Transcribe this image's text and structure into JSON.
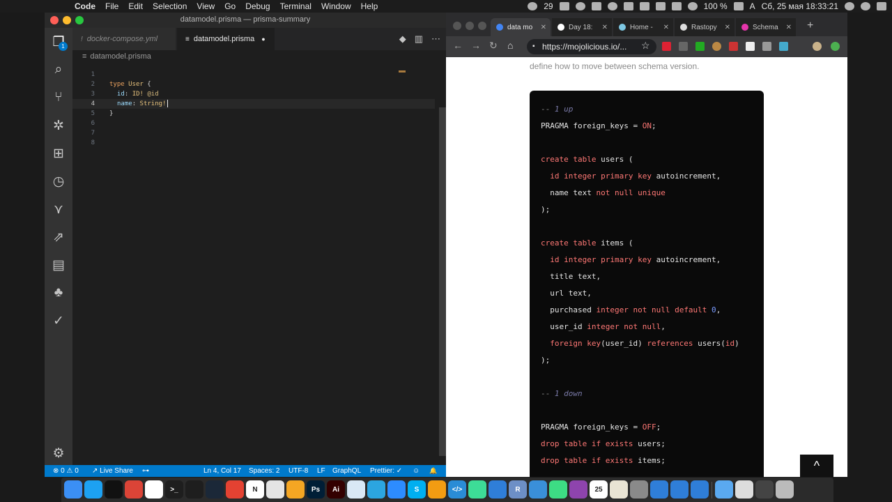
{
  "menubar": {
    "apple_glyph": "",
    "app_name": "Code",
    "items": [
      "File",
      "Edit",
      "Selection",
      "View",
      "Go",
      "Debug",
      "Terminal",
      "Window",
      "Help"
    ],
    "notifications_count": "29",
    "battery": "100 %",
    "input_source": "A",
    "datetime": "Сб, 25 мая  18:33:21"
  },
  "vscode": {
    "window_title": "datamodel.prisma — prisma-summary",
    "tabs": [
      {
        "label": "docker-compose.yml",
        "icon": "!"
      },
      {
        "label": "datamodel.prisma",
        "icon": "≡",
        "modified_dot": "●"
      }
    ],
    "explorer_badge": "1",
    "breadcrumb": "datamodel.prisma",
    "line_numbers": [
      "1",
      "2",
      "3",
      "4",
      "5",
      "6",
      "7",
      "8"
    ],
    "code": {
      "line2_kw": "type",
      "line2_name": "User",
      "line2_brace": " {",
      "line3_field": "id",
      "line3_colon": ": ",
      "line3_type": "ID!",
      "line3_attr": " @id",
      "line4_field": "name",
      "line4_colon": ": ",
      "line4_type": "String!",
      "line5_brace": "}"
    },
    "status": {
      "problems": "⊗ 0 ⚠ 0",
      "live_share": "↗ Live Share",
      "position": "Ln 4, Col 17",
      "spaces": "Spaces: 2",
      "encoding": "UTF-8",
      "eol": "LF",
      "language": "GraphQL",
      "prettier": "Prettier: ✓",
      "smiley": "☺",
      "bell": "🔔"
    }
  },
  "browser": {
    "tabs": [
      {
        "label": "data mo",
        "favicon_color": "#4285f4",
        "active": true
      },
      {
        "label": "Day 18:",
        "favicon_color": "#ffffff",
        "active": false
      },
      {
        "label": "Home -",
        "favicon_color": "#7ec8e3",
        "active": false
      },
      {
        "label": "Rastopy",
        "favicon_color": "#dddddd",
        "active": false
      },
      {
        "label": "Schema",
        "favicon_color": "#e535ab",
        "active": false
      }
    ],
    "url": "https://mojolicious.io/...",
    "page_text": "define how to move between schema version.",
    "code_lines": {
      "l1_c": "-- ",
      "l1_n": "1 up",
      "l2_a": "PRAGMA foreign_keys = ",
      "l2_b": "ON",
      "l2_c": ";",
      "l4_a": "create table",
      "l4_b": " users (",
      "l5_a": "  id integer primary key",
      "l5_b": " autoincrement,",
      "l6_a": "  name text ",
      "l6_b": "not null unique",
      "l7": ");",
      "l9_a": "create table",
      "l9_b": " items (",
      "l10_a": "  id integer primary key",
      "l10_b": " autoincrement,",
      "l11": "  title text,",
      "l12": "  url text,",
      "l13_a": "  purchased ",
      "l13_b": "integer not null default",
      "l13_c": " 0",
      "l13_d": ",",
      "l14_a": "  user_id ",
      "l14_b": "integer not null",
      "l14_c": ",",
      "l15_a": "  foreign key",
      "l15_b": "(user_id) ",
      "l15_c": "references",
      "l15_d": " users(",
      "l15_e": "id",
      "l15_f": ")",
      "l16": ");",
      "l18_c": "-- ",
      "l18_n": "1 down",
      "l20_a": "PRAGMA foreign_keys = ",
      "l20_b": "OFF",
      "l20_c": ";",
      "l21_a": "drop table if exists",
      "l21_b": " users;",
      "l22_a": "drop table if exists",
      "l22_b": " items;"
    },
    "scroll_top_glyph": "^"
  },
  "dock": {
    "apps": [
      {
        "name": "finder",
        "color": "#3b8ff5",
        "glyph": ""
      },
      {
        "name": "tweetbot",
        "color": "#1da1f2",
        "glyph": ""
      },
      {
        "name": "safari",
        "color": "#111111",
        "glyph": ""
      },
      {
        "name": "chrome",
        "color": "#db4437",
        "glyph": ""
      },
      {
        "name": "slack",
        "color": "#ffffff",
        "glyph": ""
      },
      {
        "name": "terminal",
        "color": "#1e1e1e",
        "glyph": ">_"
      },
      {
        "name": "iterm",
        "color": "#1e1e1e",
        "glyph": ""
      },
      {
        "name": "steam",
        "color": "#1b2838",
        "glyph": ""
      },
      {
        "name": "todoist",
        "color": "#e44232",
        "glyph": ""
      },
      {
        "name": "notion",
        "color": "#ffffff",
        "glyph": "N"
      },
      {
        "name": "things",
        "color": "#e4e4e4",
        "glyph": ""
      },
      {
        "name": "books",
        "color": "#f5a623",
        "glyph": ""
      },
      {
        "name": "photoshop",
        "color": "#001e36",
        "glyph": "Ps"
      },
      {
        "name": "illustrator",
        "color": "#330000",
        "glyph": "Ai"
      },
      {
        "name": "mail",
        "color": "#d9e8f5",
        "glyph": ""
      },
      {
        "name": "telegram",
        "color": "#2ca5e0",
        "glyph": ""
      },
      {
        "name": "zoom",
        "color": "#2d8cff",
        "glyph": ""
      },
      {
        "name": "skype",
        "color": "#00aff0",
        "glyph": "S"
      },
      {
        "name": "paw",
        "color": "#f39c12",
        "glyph": ""
      },
      {
        "name": "brackets",
        "color": "#2a8cd6",
        "glyph": "</>"
      },
      {
        "name": "atom",
        "color": "#3ddc97",
        "glyph": ""
      },
      {
        "name": "vscode",
        "color": "#2f7ed8",
        "glyph": ""
      },
      {
        "name": "r",
        "color": "#6d8fc6",
        "glyph": "R"
      },
      {
        "name": "sequelpro",
        "color": "#3a8fd9",
        "glyph": ""
      },
      {
        "name": "android",
        "color": "#3ddc84",
        "glyph": ""
      },
      {
        "name": "app-purple",
        "color": "#8e44ad",
        "glyph": ""
      },
      {
        "name": "calendar",
        "color": "#ffffff",
        "glyph": "25"
      },
      {
        "name": "notes",
        "color": "#e9e4d4",
        "glyph": ""
      },
      {
        "name": "system-prefs",
        "color": "#8a8a8a",
        "glyph": ""
      },
      {
        "name": "vscode-2",
        "color": "#2f7ed8",
        "glyph": ""
      },
      {
        "name": "vscode-3",
        "color": "#2f7ed8",
        "glyph": ""
      },
      {
        "name": "vscode-4",
        "color": "#2f7ed8",
        "glyph": ""
      },
      {
        "name": "folder",
        "color": "#5aa9f0",
        "glyph": ""
      },
      {
        "name": "preview",
        "color": "#dddddd",
        "glyph": ""
      },
      {
        "name": "screen",
        "color": "#444444",
        "glyph": ""
      },
      {
        "name": "trash",
        "color": "#bbbbbb",
        "glyph": ""
      }
    ]
  }
}
